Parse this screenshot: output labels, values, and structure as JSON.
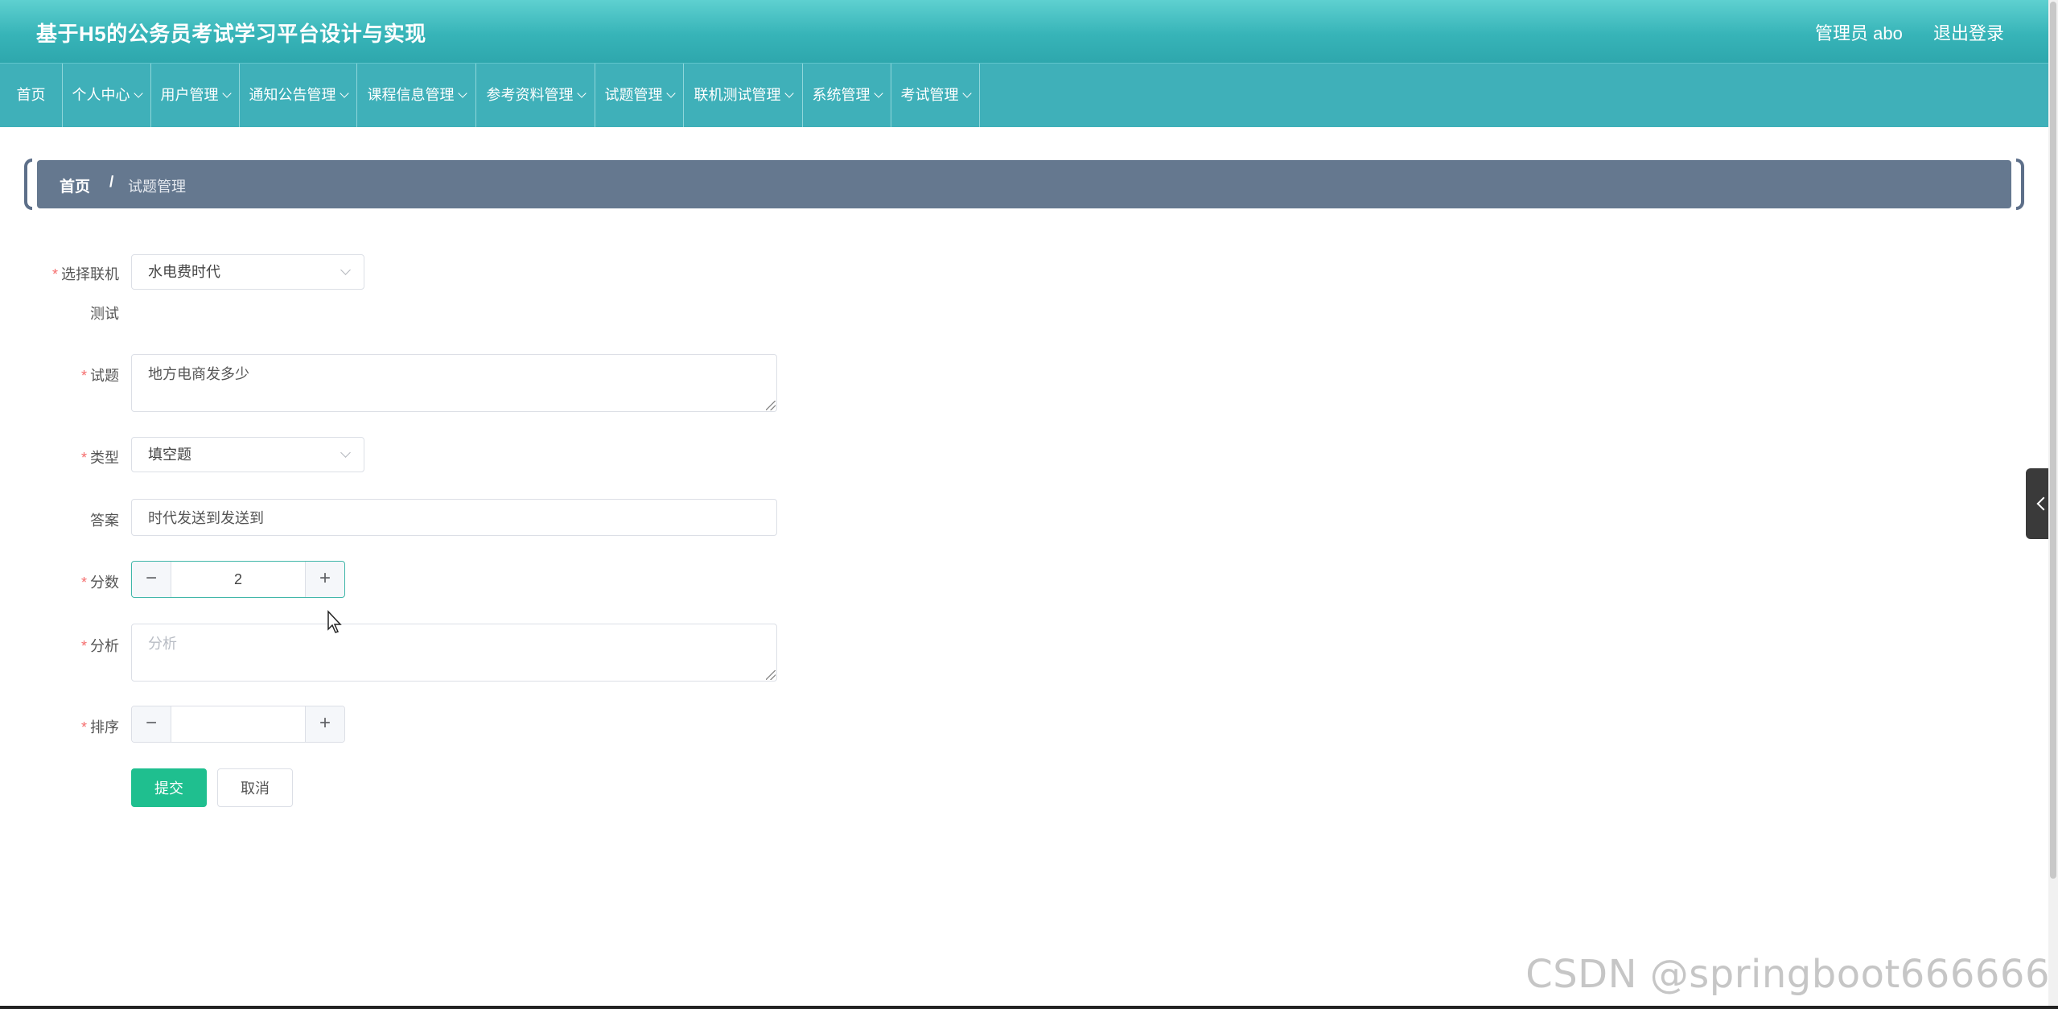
{
  "header": {
    "site_title": "基于H5的公务员考试学习平台设计与实现",
    "user_label": "管理员 abo",
    "logout_label": "退出登录"
  },
  "nav": {
    "items": [
      {
        "label": "首页",
        "dropdown": false
      },
      {
        "label": "个人中心",
        "dropdown": true
      },
      {
        "label": "用户管理",
        "dropdown": true
      },
      {
        "label": "通知公告管理",
        "dropdown": true
      },
      {
        "label": "课程信息管理",
        "dropdown": true
      },
      {
        "label": "参考资料管理",
        "dropdown": true
      },
      {
        "label": "试题管理",
        "dropdown": true
      },
      {
        "label": "联机测试管理",
        "dropdown": true
      },
      {
        "label": "系统管理",
        "dropdown": true
      },
      {
        "label": "考试管理",
        "dropdown": true
      }
    ]
  },
  "breadcrumb": {
    "home": "首页",
    "separator": "/",
    "current": "试题管理"
  },
  "form": {
    "test_label_line1": "选择联机",
    "test_label_line2": "测试",
    "test_value": "水电费时代",
    "question_label": "试题",
    "question_value": "地方电商发多少",
    "type_label": "类型",
    "type_value": "填空题",
    "answer_label": "答案",
    "answer_value": "时代发送到发送到",
    "score_label": "分数",
    "score_value": "2",
    "analysis_label": "分析",
    "analysis_placeholder": "分析",
    "sort_label": "排序",
    "sort_value": "",
    "required_mark": "*",
    "submit_label": "提交",
    "cancel_label": "取消"
  },
  "stepper_symbols": {
    "minus": "−",
    "plus": "+"
  },
  "watermark": "CSDN @springboot666666",
  "colors": {
    "header_teal": "#37b4b8",
    "nav_teal": "#3fb0b9",
    "breadcrumb_slate": "#65788f",
    "submit_green": "#1fbf8f",
    "required_red": "#f56c6c"
  },
  "icons": {
    "dropdown": "chevron-down-icon",
    "side_toggle": "chevron-left-icon",
    "cursor": "mouse-pointer-icon"
  }
}
